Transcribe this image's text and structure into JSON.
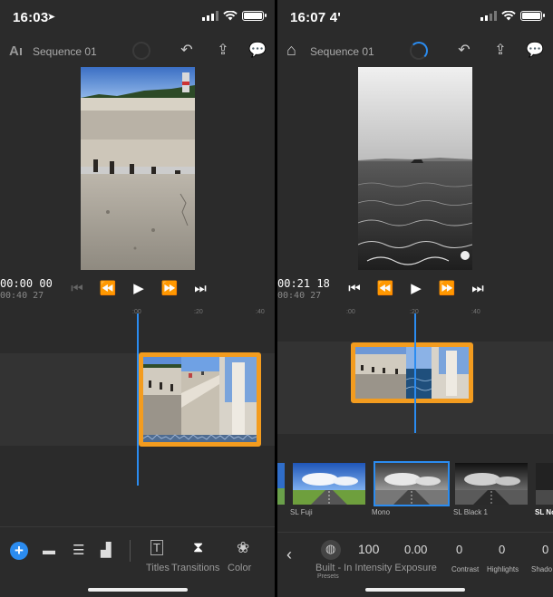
{
  "left": {
    "status_time": "16:03",
    "sequence_title": "Sequence 01",
    "timecode_current": "00:00 00",
    "timecode_total": "00:40 27",
    "ruler_ticks": [
      ":00",
      ":20",
      ":40"
    ],
    "toolbar_labels": {
      "titles": "Titles",
      "transitions": "Transitions",
      "color": "Color"
    },
    "logo_text": "Aı"
  },
  "right": {
    "status_time": "16:07 4'",
    "sequence_title": "Sequence 01",
    "timecode_current": "00:21 18",
    "timecode_total": "00:40 27",
    "ruler_ticks": [
      ":00",
      ":20",
      ":40"
    ],
    "filters": [
      {
        "label": "SL Fuji",
        "selected": false
      },
      {
        "label": "Mono",
        "selected": true
      },
      {
        "label": "SL Black 1",
        "selected": false
      },
      {
        "label": "SL No",
        "selected": false
      }
    ],
    "adjustments": {
      "preset_value": "100",
      "exposure_value": "0.00",
      "contrast_value": "0",
      "highlights_value": "0",
      "shadows_value": "0",
      "presets_label": "Presets",
      "group_label": "Built - In Intensity Exposure",
      "contrast_label": "Contrast",
      "highlights_label": "Highlights",
      "shadows_label": "Shado"
    }
  },
  "colors": {
    "accent_blue": "#2b8cf0",
    "clip_orange": "#f39c1f",
    "background": "#2b2b2b"
  }
}
